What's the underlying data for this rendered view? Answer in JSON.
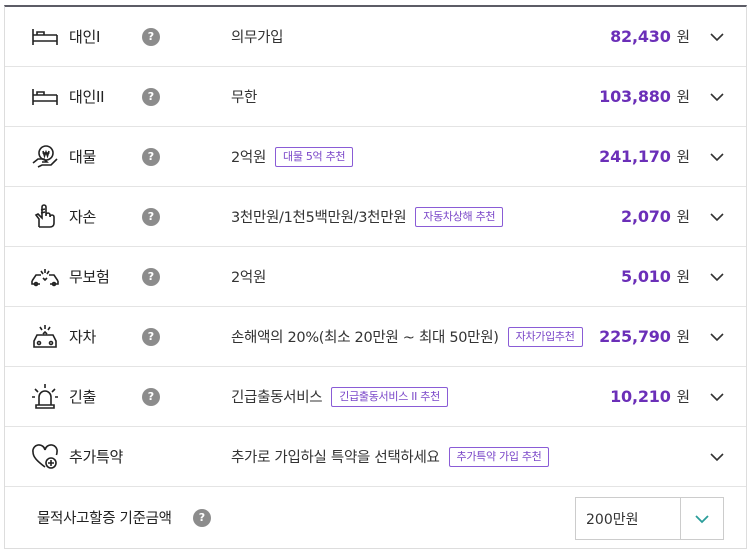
{
  "colors": {
    "accent": "#6b2fb8",
    "badge": "#7a46c8",
    "chevron_select": "#2a9d9a",
    "help": "#8c8c8c"
  },
  "coverages": [
    {
      "icon": "bed-icon",
      "name": "대인I",
      "help": "?",
      "desc": "의무가입",
      "badge": "",
      "amount": "82,430",
      "unit": "원"
    },
    {
      "icon": "bed-icon",
      "name": "대인II",
      "help": "?",
      "desc": "무한",
      "badge": "",
      "amount": "103,880",
      "unit": "원"
    },
    {
      "icon": "money-hand-icon",
      "name": "대물",
      "help": "?",
      "desc": "2억원",
      "badge": "대물 5억 추천",
      "amount": "241,170",
      "unit": "원"
    },
    {
      "icon": "bandaged-hand-icon",
      "name": "자손",
      "help": "?",
      "desc": "3천만원/1천5백만원/3천만원",
      "badge": "자동차상해 추천",
      "amount": "2,070",
      "unit": "원"
    },
    {
      "icon": "car-crash-icon",
      "name": "무보험",
      "help": "?",
      "desc": "2억원",
      "badge": "",
      "amount": "5,010",
      "unit": "원"
    },
    {
      "icon": "car-damage-icon",
      "name": "자차",
      "help": "?",
      "desc": "손해액의 20%(최소 20만원 ~ 최대 50만원)",
      "badge": "자차가입추천",
      "amount": "225,790",
      "unit": "원"
    },
    {
      "icon": "siren-icon",
      "name": "긴출",
      "help": "?",
      "desc": "긴급출동서비스",
      "badge": "긴급출동서비스 II 추천",
      "amount": "10,210",
      "unit": "원"
    },
    {
      "icon": "heart-plus-icon",
      "name": "추가특약",
      "help": "",
      "desc": "추가로 가입하실 특약을 선택하세요",
      "badge": "추가특약 가입 추천",
      "amount": "",
      "unit": ""
    }
  ],
  "footer": {
    "label": "물적사고할증 기준금액",
    "help": "?",
    "selected": "200만원"
  }
}
